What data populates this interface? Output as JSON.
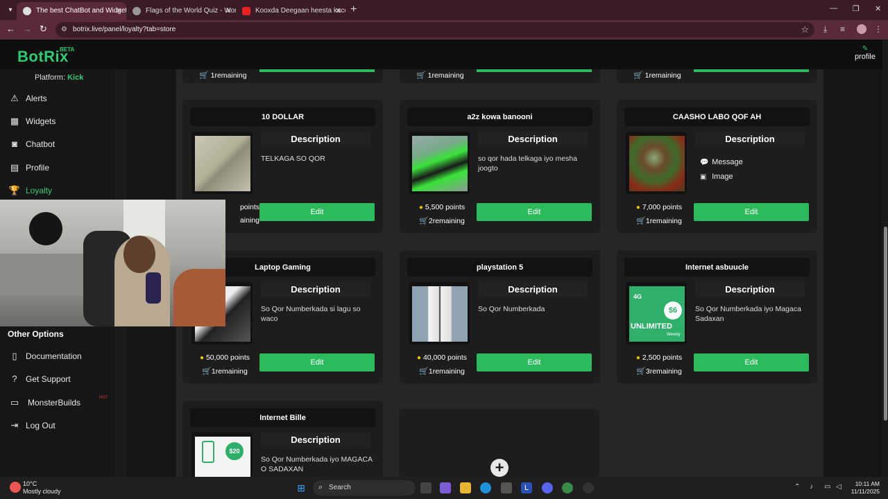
{
  "browser": {
    "tabs": [
      {
        "title": "The best ChatBot and Widgets",
        "active": true
      },
      {
        "title": "Flags of the World Quiz - World",
        "active": false
      },
      {
        "title": "Kooxda Deegaan heesta kacdan",
        "active": false
      }
    ],
    "url": "botrix.live/panel/loyalty?tab=store"
  },
  "header": {
    "logo": "BotRix",
    "beta": "BETA",
    "profile_label": "profile"
  },
  "sidebar": {
    "platform_label": "Platform:",
    "platform_value": "Kick",
    "items": [
      {
        "label": "Alerts",
        "icon": "warning-icon"
      },
      {
        "label": "Widgets",
        "icon": "grid-icon"
      },
      {
        "label": "Chatbot",
        "icon": "robot-icon"
      },
      {
        "label": "Profile",
        "icon": "id-card-icon"
      },
      {
        "label": "Loyalty",
        "icon": "trophy-icon"
      }
    ],
    "other_title": "Other Options",
    "other_items": [
      {
        "label": "Documentation",
        "icon": "document-icon"
      },
      {
        "label": "Get Support",
        "icon": "question-icon"
      },
      {
        "label": "MonsterBuilds",
        "icon": "laptop-icon"
      },
      {
        "label": "Log Out",
        "icon": "logout-icon"
      }
    ],
    "hot_badge": "HOT"
  },
  "store": {
    "top_strip": [
      "1remaining",
      "1remaining",
      "1remaining"
    ],
    "description_heading": "Description",
    "edit_label": "Edit",
    "items": [
      {
        "title": "10 DOLLAR",
        "description": "TELKAGA SO QOR",
        "points": "points",
        "remaining": "aining"
      },
      {
        "title": "a2z kowa banooni",
        "description": "so qor hada telkaga iyo mesha joogto",
        "points": "5,500 points",
        "remaining": "2remaining"
      },
      {
        "title": "CAASHO LABO QOF AH",
        "options": [
          "Message",
          "Image"
        ],
        "points": "7,000 points",
        "remaining": "1remaining"
      },
      {
        "title": "Laptop Gaming",
        "description": "So Qor Numberkada si lagu so waco",
        "points": "50,000 points",
        "remaining": "1remaining"
      },
      {
        "title": "playstation 5",
        "description": "So Qor Numberkada",
        "points": "40,000 points",
        "remaining": "1remaining"
      },
      {
        "title": "Internet asbuucle",
        "description": "So Qor Numberkada iyo Magaca Sadaxan",
        "points": "2,500 points",
        "remaining": "3remaining"
      },
      {
        "title": "Internet Bille",
        "description": "So Qor Numberkada iyo MAGACA O SADAXAN"
      }
    ],
    "image_labels": {
      "internet_asbuucle": {
        "price": "$6",
        "text": "UNLIMITED",
        "tag": "4G",
        "weekly": "Weekly"
      },
      "internet_bille": {
        "price": "$20"
      }
    }
  },
  "taskbar": {
    "temperature": "10°C",
    "weather": "Mostly cloudy",
    "search_placeholder": "Search",
    "time": "10:11 AM",
    "date": "11/11/2025"
  },
  "colors": {
    "accent": "#2ecc71",
    "button": "#2dba5d",
    "browser_frame": "#5a2a3a"
  }
}
